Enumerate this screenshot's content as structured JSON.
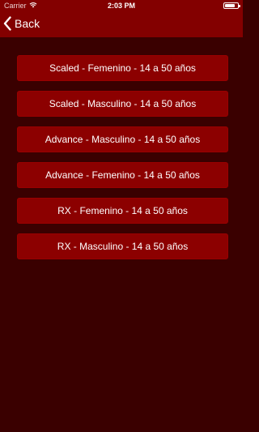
{
  "status_bar": {
    "carrier": "Carrier",
    "wifi_icon": "wifi-icon",
    "time": "2:03 PM",
    "battery_icon": "battery-icon",
    "battery_level": 0.8
  },
  "nav": {
    "back_label": "Back",
    "back_icon": "chevron-left-icon"
  },
  "options": [
    {
      "label": "Scaled - Femenino - 14 a 50 años"
    },
    {
      "label": "Scaled - Masculino - 14 a 50 años"
    },
    {
      "label": "Advance - Masculino - 14 a 50 años"
    },
    {
      "label": "Advance - Femenino - 14 a 50 años"
    },
    {
      "label": "RX - Femenino - 14 a 50 años"
    },
    {
      "label": "RX - Masculino - 14 a 50 años"
    }
  ],
  "colors": {
    "background": "#3a0000",
    "nav_bar": "#830000",
    "button": "#8c0000",
    "text": "#ffffff"
  }
}
